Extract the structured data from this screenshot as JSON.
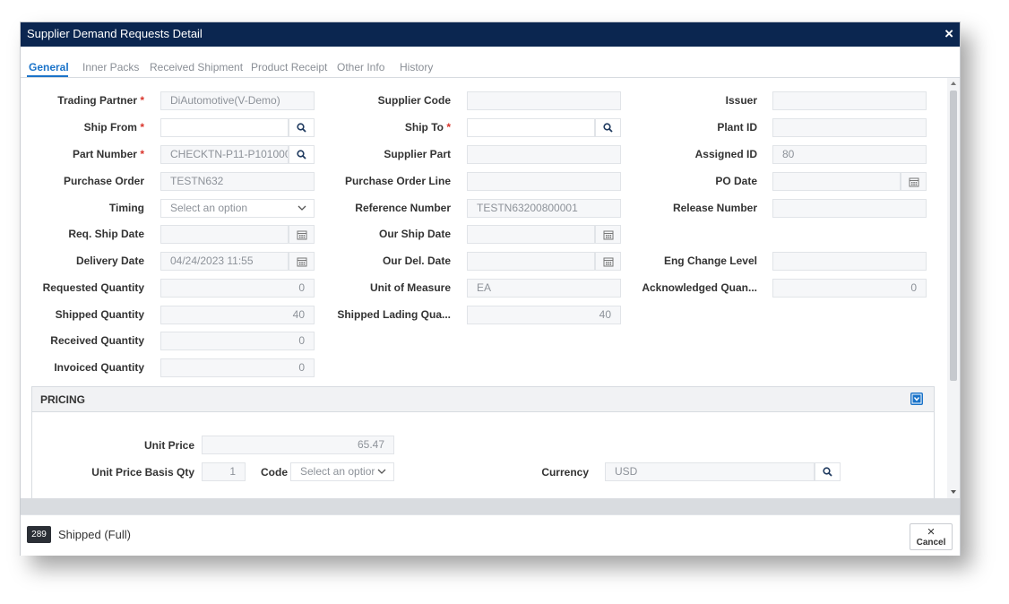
{
  "dialog": {
    "title": "Supplier Demand Requests Detail",
    "close": "×"
  },
  "tabs": [
    "General",
    "Inner Packs",
    "Received Shipment",
    "Product Receipt",
    "Other Info",
    "History"
  ],
  "form": {
    "trading_partner": {
      "label": "Trading Partner",
      "value": "DiAutomotive(V-Demo)"
    },
    "ship_from": {
      "label": "Ship From",
      "value": ""
    },
    "part_number": {
      "label": "Part Number",
      "value": "CHECKTN-P11-P101000-("
    },
    "purchase_order": {
      "label": "Purchase Order",
      "value": "TESTN632"
    },
    "timing": {
      "label": "Timing",
      "value": "Select an option"
    },
    "req_ship_date": {
      "label": "Req. Ship Date",
      "value": ""
    },
    "delivery_date": {
      "label": "Delivery Date",
      "value": "04/24/2023 11:55"
    },
    "requested_quantity": {
      "label": "Requested Quantity",
      "value": "0"
    },
    "shipped_quantity": {
      "label": "Shipped Quantity",
      "value": "40"
    },
    "received_quantity": {
      "label": "Received Quantity",
      "value": "0"
    },
    "invoiced_quantity": {
      "label": "Invoiced Quantity",
      "value": "0"
    },
    "supplier_code": {
      "label": "Supplier Code",
      "value": ""
    },
    "ship_to": {
      "label": "Ship To",
      "value": ""
    },
    "supplier_part": {
      "label": "Supplier Part",
      "value": ""
    },
    "purchase_order_line": {
      "label": "Purchase Order Line",
      "value": ""
    },
    "reference_number": {
      "label": "Reference Number",
      "value": "TESTN63200800001"
    },
    "our_ship_date": {
      "label": "Our Ship Date",
      "value": ""
    },
    "our_del_date": {
      "label": "Our Del. Date",
      "value": ""
    },
    "unit_of_measure": {
      "label": "Unit of Measure",
      "value": "EA"
    },
    "shipped_lading_qua": {
      "label": "Shipped Lading Qua...",
      "value": "40"
    },
    "issuer": {
      "label": "Issuer",
      "value": ""
    },
    "plant_id": {
      "label": "Plant ID",
      "value": ""
    },
    "assigned_id": {
      "label": "Assigned ID",
      "value": "80"
    },
    "po_date": {
      "label": "PO Date",
      "value": ""
    },
    "release_number": {
      "label": "Release Number",
      "value": ""
    },
    "eng_change_level": {
      "label": "Eng Change Level",
      "value": ""
    },
    "acknowledged_quan": {
      "label": "Acknowledged Quan...",
      "value": "0"
    },
    "required_mark": "*"
  },
  "pricing": {
    "title": "PRICING",
    "unit_price": {
      "label": "Unit Price",
      "value": "65.47"
    },
    "unit_price_basis_qty": {
      "label": "Unit Price Basis Qty",
      "value": "1"
    },
    "code": {
      "label": "Code",
      "value": "Select an optior"
    },
    "currency": {
      "label": "Currency",
      "value": "USD"
    }
  },
  "footer": {
    "badge": "289",
    "status": "Shipped (Full)",
    "cancel_label": "Cancel",
    "cancel_icon": "×"
  },
  "colors": {
    "titlebar": "#0b2650",
    "accent": "#1a73c9",
    "required": "#d9342b"
  }
}
